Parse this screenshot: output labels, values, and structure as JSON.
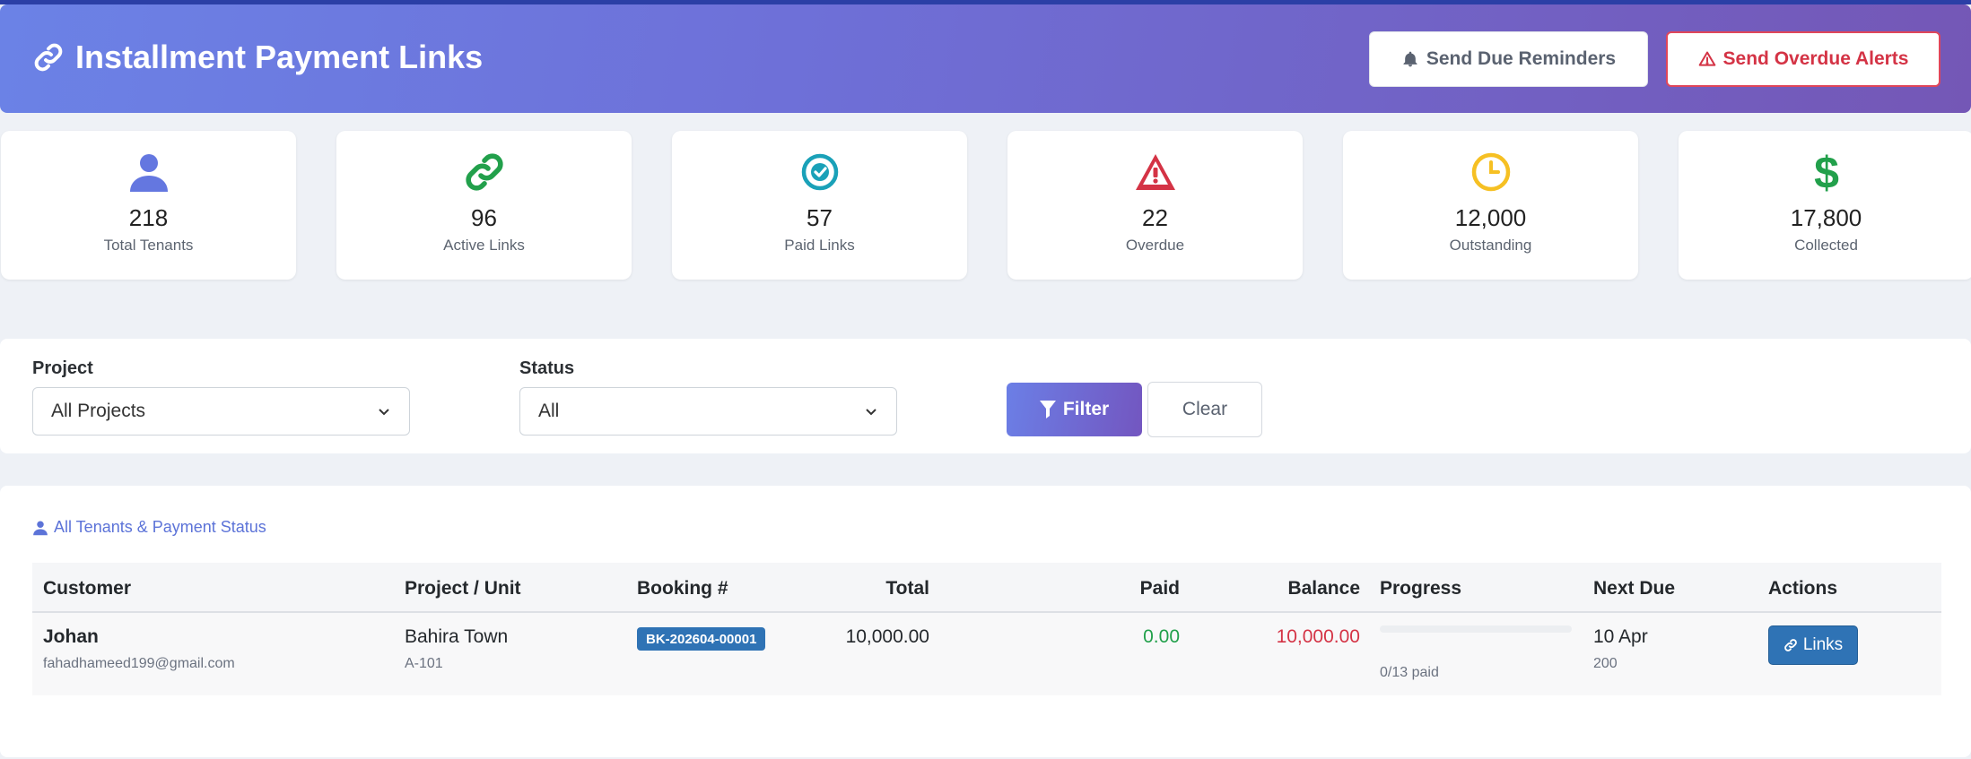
{
  "header": {
    "title": "Installment Payment Links",
    "send_reminders_label": "Send Due Reminders",
    "send_overdue_label": "Send Overdue Alerts"
  },
  "stats": [
    {
      "value": "218",
      "label": "Total Tenants",
      "icon": "user-icon",
      "color": "#6477e0"
    },
    {
      "value": "96",
      "label": "Active Links",
      "icon": "link-icon",
      "color": "#22a04b"
    },
    {
      "value": "57",
      "label": "Paid Links",
      "icon": "check-circle-icon",
      "color": "#1aa1b8"
    },
    {
      "value": "22",
      "label": "Overdue",
      "icon": "warning-icon",
      "color": "#d43345"
    },
    {
      "value": "12,000",
      "label": "Outstanding",
      "icon": "clock-icon",
      "color": "#f6c023"
    },
    {
      "value": "17,800",
      "label": "Collected",
      "icon": "dollar-icon",
      "color": "#22a04b"
    }
  ],
  "filters": {
    "project_label": "Project",
    "project_value": "All Projects",
    "status_label": "Status",
    "status_value": "All",
    "filter_button": "Filter",
    "clear_button": "Clear"
  },
  "table": {
    "section_title": "All Tenants & Payment Status",
    "columns": {
      "customer": "Customer",
      "project_unit": "Project / Unit",
      "booking": "Booking #",
      "total": "Total",
      "paid": "Paid",
      "balance": "Balance",
      "progress": "Progress",
      "next_due": "Next Due",
      "actions": "Actions"
    },
    "rows": [
      {
        "customer_name": "Johan",
        "customer_email": "fahadhameed199@gmail.com",
        "project": "Bahira Town",
        "unit": "A-101",
        "booking": "BK-202604-00001",
        "total": "10,000.00",
        "paid": "0.00",
        "balance": "10,000.00",
        "progress_fraction": 0,
        "progress_text": "0/13 paid",
        "next_due_date": "10 Apr",
        "next_due_amount": "200",
        "action_label": "Links"
      }
    ]
  },
  "colors": {
    "accent": "#6b7fe6",
    "paid_green": "#22a04b",
    "balance_red": "#d43345",
    "badge_blue": "#2f73b5"
  }
}
